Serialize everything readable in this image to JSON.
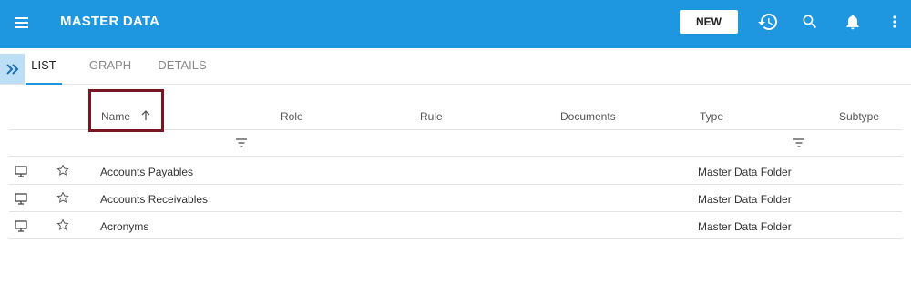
{
  "header": {
    "title": "MASTER DATA",
    "new_label": "NEW",
    "color": "#1f96e0",
    "icons": [
      "menu-icon",
      "history-icon",
      "search-icon",
      "bell-icon",
      "more-vert-icon"
    ]
  },
  "tabs": [
    {
      "label": "LIST",
      "active": true
    },
    {
      "label": "GRAPH",
      "active": false
    },
    {
      "label": "DETAILS",
      "active": false
    }
  ],
  "table": {
    "columns": [
      "Name",
      "Role",
      "Rule",
      "Documents",
      "Type",
      "Subtype"
    ],
    "sort": {
      "column": "Name",
      "direction": "ascending"
    },
    "rows": [
      {
        "name": "Accounts Payables",
        "type": "Master Data Folder"
      },
      {
        "name": "Accounts Receivables",
        "type": "Master Data Folder"
      },
      {
        "name": "Acronyms",
        "type": "Master Data Folder"
      }
    ]
  }
}
